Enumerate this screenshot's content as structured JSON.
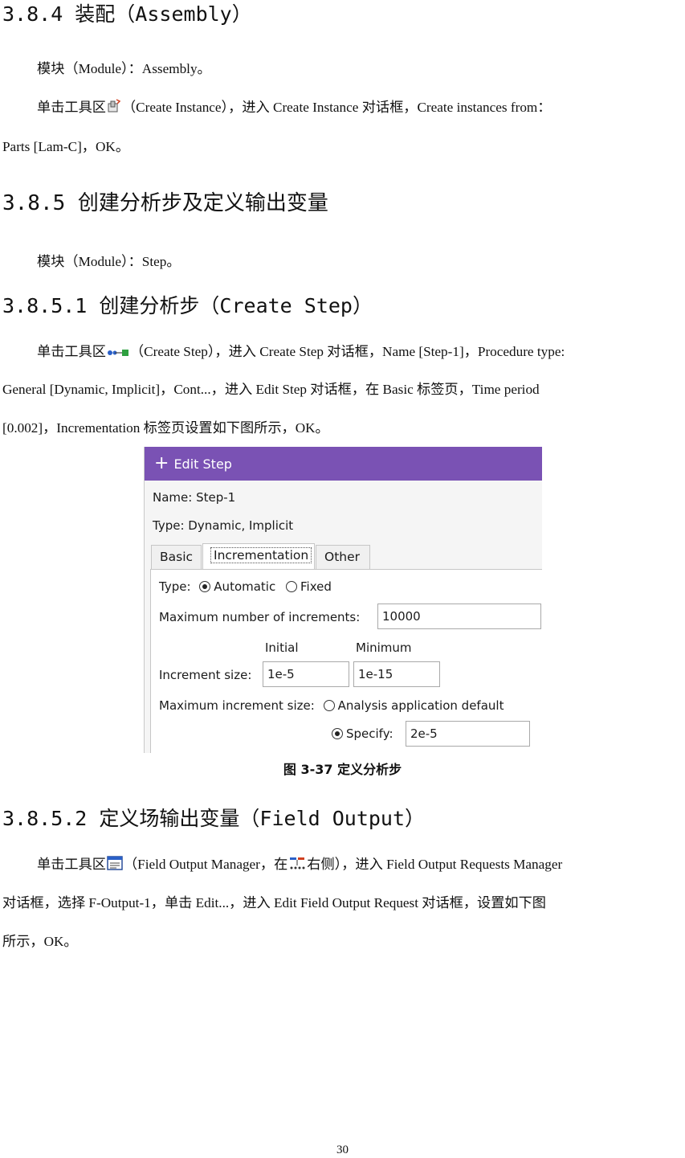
{
  "sections": {
    "s384_title": "3.8.4 装配（Assembly）",
    "s384_module": "模块（Module）：Assembly。",
    "s384_p1_a": "单击工具区",
    "s384_p1_b": "（Create Instance），进入 Create Instance 对话框，Create instances from：",
    "s384_p1_c": "Parts [Lam-C]，OK。",
    "s385_title": "3.8.5 创建分析步及定义输出变量",
    "s385_module": "模块（Module）：Step。",
    "s3851_title": "3.8.5.1 创建分析步（Create Step）",
    "s3851_p1_a": "单击工具区",
    "s3851_p1_b": "（Create Step），进入 Create Step 对话框，Name [Step-1]，Procedure type:",
    "s3851_p2": "General [Dynamic, Implicit]，Cont...，进入 Edit Step 对话框，在 Basic 标签页，Time period",
    "s3851_p3": "[0.002]，Incrementation 标签页设置如下图所示，OK。",
    "figure_caption": "图 3-37   定义分析步",
    "s3852_title": "3.8.5.2 定义场输出变量（Field Output）",
    "s3852_p1_a": "单击工具区",
    "s3852_p1_b": "（Field Output Manager，在",
    "s3852_p1_c": "右侧），进入 Field Output Requests Manager",
    "s3852_p2": "对话框，选择 F-Output-1，单击 Edit...，进入 Edit Field Output Request 对话框，设置如下图",
    "s3852_p3": "所示，OK。",
    "page_number": "30"
  },
  "dialog": {
    "title": "Edit Step",
    "name_label": "Name:",
    "name_value": "Step-1",
    "type_label": "Type:",
    "type_value": "Dynamic, Implicit",
    "tabs": [
      "Basic",
      "Incrementation",
      "Other"
    ],
    "active_tab": "Incrementation",
    "inc_type_label": "Type:",
    "inc_type_options": [
      "Automatic",
      "Fixed"
    ],
    "inc_type_selected": "Automatic",
    "max_increments_label": "Maximum number of increments:",
    "max_increments_value": "10000",
    "col_initial": "Initial",
    "col_minimum": "Minimum",
    "increment_size_label": "Increment size:",
    "initial_value": "1e-5",
    "minimum_value": "1e-15",
    "max_increment_label": "Maximum increment size:",
    "max_increment_options": [
      "Analysis application default",
      "Specify:"
    ],
    "max_increment_selected": "Specify:",
    "specify_value": "2e-5"
  },
  "icons": {
    "create_instance": "create-instance-icon",
    "create_step": "create-step-icon",
    "field_output_manager": "field-output-manager-icon",
    "step_manager": "step-manager-icon"
  },
  "colors": {
    "dialog_title_bar": "#7a52b4"
  }
}
